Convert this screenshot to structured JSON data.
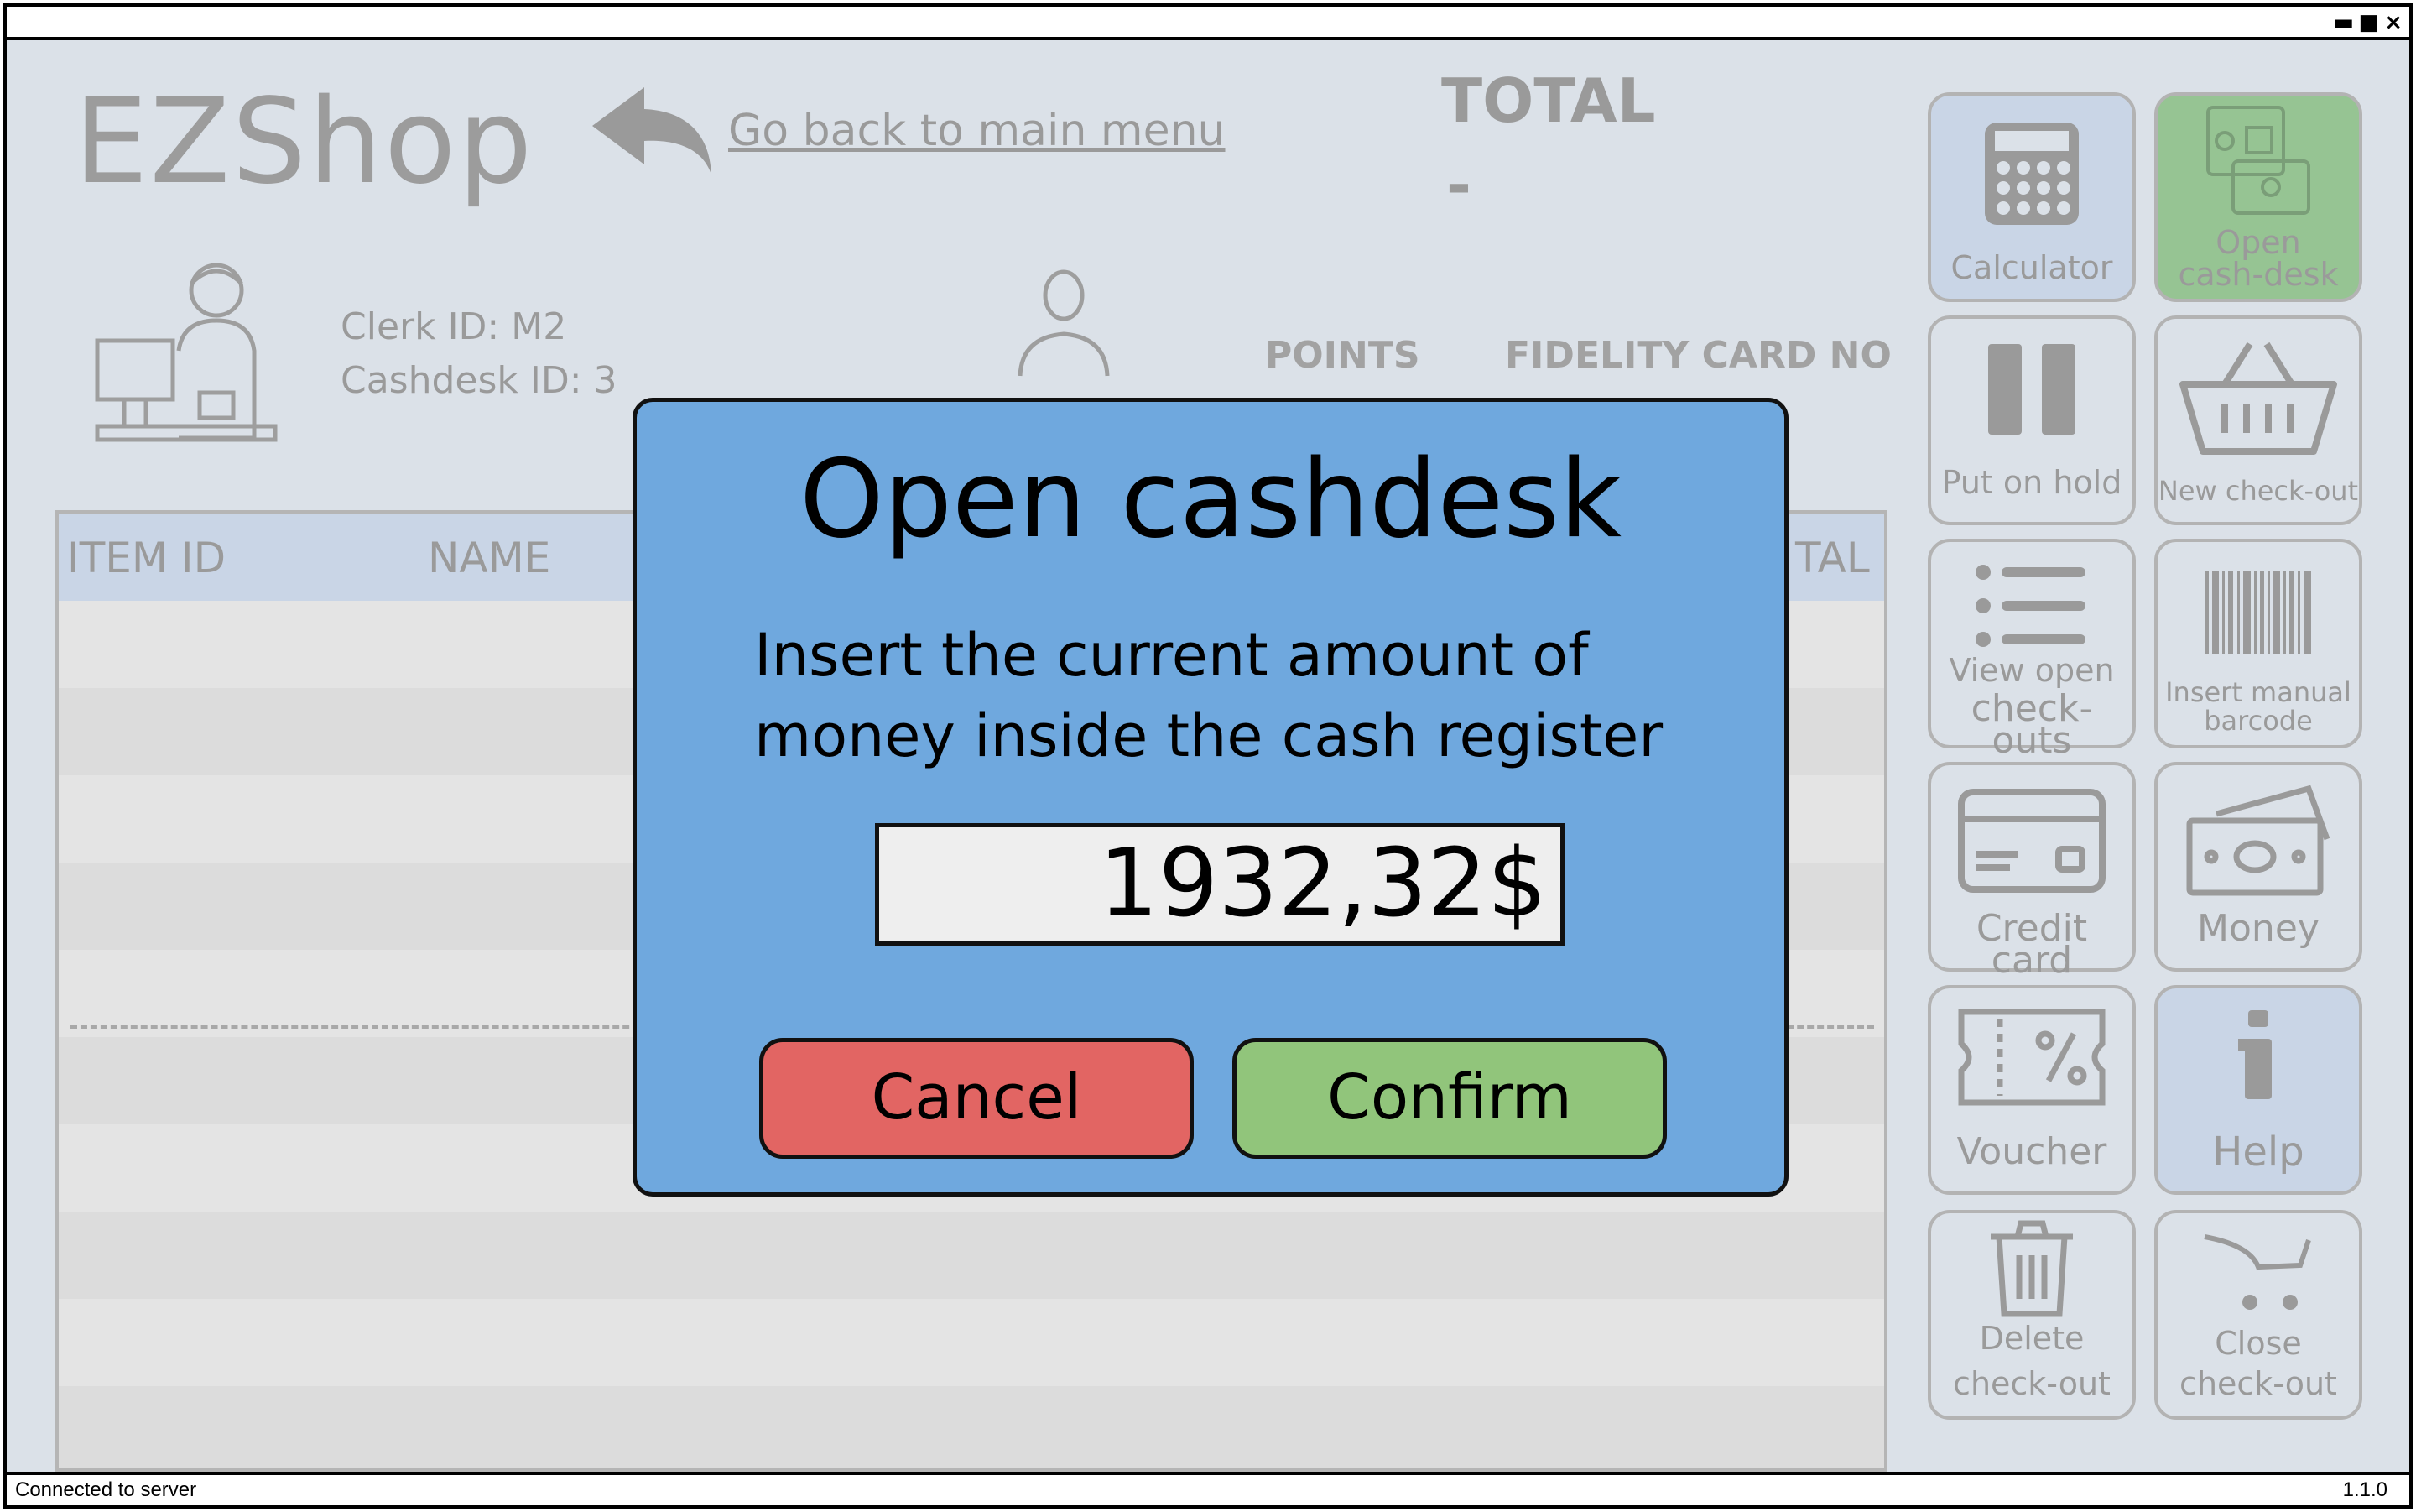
{
  "window": {
    "controls": {
      "minimize": "▬",
      "maximize": "■",
      "close": "×"
    }
  },
  "header": {
    "logo": "EZShop",
    "back_link": "Go back to main menu",
    "total_label": "TOTAL",
    "total_value": "-"
  },
  "clerk": {
    "clerk_id": "Clerk ID: M2",
    "cashdesk_id": "Cashdesk ID: 3"
  },
  "customer": {
    "points_label": "POINTS",
    "fidelity_label": "FIDELITY CARD NO"
  },
  "table": {
    "columns": [
      "ITEM ID",
      "NAME",
      "TAL"
    ]
  },
  "panel": {
    "calculator": "Calculator",
    "open_cashdesk_1": "Open",
    "open_cashdesk_2": "cash-desk",
    "put_on_hold": "Put on hold",
    "new_checkout": "New check-out",
    "view_open_1": "View open",
    "view_open_2": "check-outs",
    "insert_manual_1": "Insert manual",
    "insert_manual_2": "barcode",
    "credit_card": "Credit card",
    "money": "Money",
    "voucher": "Voucher",
    "help": "Help",
    "delete_1": "Delete",
    "delete_2": "check-out",
    "close_1": "Close",
    "close_2": "check-out"
  },
  "dialog": {
    "title": "Open cashdesk",
    "message_line1": "Insert the current amount of",
    "message_line2": "money inside the cash register",
    "amount_value": "1932,32$",
    "cancel_label": "Cancel",
    "confirm_label": "Confirm"
  },
  "statusbar": {
    "status": "Connected to server",
    "version": "1.1.0"
  },
  "colors": {
    "background": "#dbe1e8",
    "dialog": "#6fa8de",
    "cancel": "#e26563",
    "confirm": "#91c57b",
    "open_cashdesk_button": "#96c493",
    "highlight_blue": "#c9d5e6"
  }
}
